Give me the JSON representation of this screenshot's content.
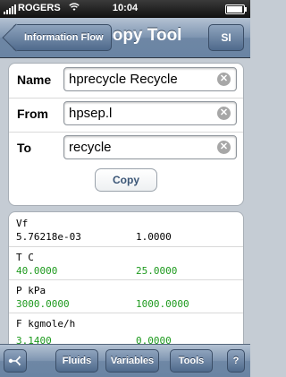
{
  "status_bar": {
    "carrier": "ROGERS",
    "time": "10:04",
    "battery_level": 0.85
  },
  "nav": {
    "back_label": "Information Flow",
    "title": "Copy Tool",
    "right_label": "SI"
  },
  "form": {
    "rows": [
      {
        "label": "Name",
        "value": "hprecycle Recycle"
      },
      {
        "label": "From",
        "value": "hpsep.l"
      },
      {
        "label": "To",
        "value": "recycle"
      }
    ],
    "copy_label": "Copy"
  },
  "results": [
    {
      "header": "Vf",
      "values": [
        "5.76218e-03",
        "1.0000"
      ],
      "color": "#000000"
    },
    {
      "header": "T C",
      "values": [
        "40.0000",
        "25.0000"
      ],
      "color": "#1e9a1e"
    },
    {
      "header": "P kPa",
      "values": [
        "3000.0000",
        "1000.0000"
      ],
      "color": "#1e9a1e"
    },
    {
      "header": "F kgmole/h",
      "values": [
        "3.1400",
        "0.0000"
      ],
      "color": "#1e9a1e"
    }
  ],
  "tabbar": {
    "fluids": "Fluids",
    "variables": "Variables",
    "tools": "Tools",
    "help": "?"
  }
}
